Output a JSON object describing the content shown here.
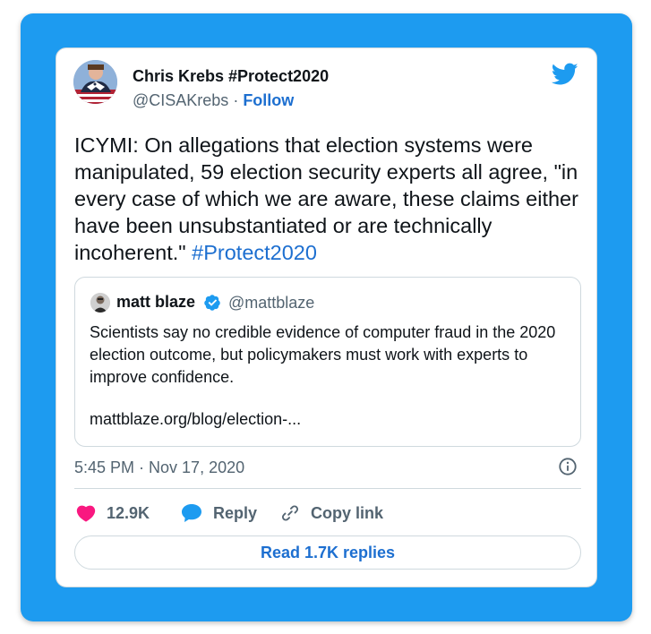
{
  "tweet": {
    "author": {
      "name": "Chris Krebs #Protect2020",
      "handle": "@CISAKrebs",
      "separator": " · ",
      "follow_label": "Follow",
      "avatar_icon": "eagle-avatar-icon"
    },
    "logo_icon": "twitter-bird-icon",
    "text": "ICYMI: On allegations that election systems were manipulated, 59 election security experts all agree, \"in every case of which we are aware, these claims either have been unsubstantiated or are technically incoherent.\" ",
    "hashtag": "#Protect2020",
    "quote": {
      "name": "matt blaze",
      "handle": "@mattblaze",
      "verified_icon": "verified-badge-icon",
      "text": "Scientists say no credible evidence of computer fraud in the 2020 election outcome, but policymakers must work with experts to improve confidence.",
      "link": "mattblaze.org/blog/election-..."
    },
    "timestamp": "5:45 PM · Nov 17, 2020",
    "info_icon": "info-icon",
    "actions": {
      "likes": "12.9K",
      "reply_label": "Reply",
      "copy_link_label": "Copy link"
    },
    "read_replies_label": "Read 1.7K replies"
  },
  "colors": {
    "background": "#1d9bf0",
    "link": "#1d6fd0",
    "like": "#f91880",
    "reply": "#1d9bf0",
    "secondary_text": "#536471"
  }
}
